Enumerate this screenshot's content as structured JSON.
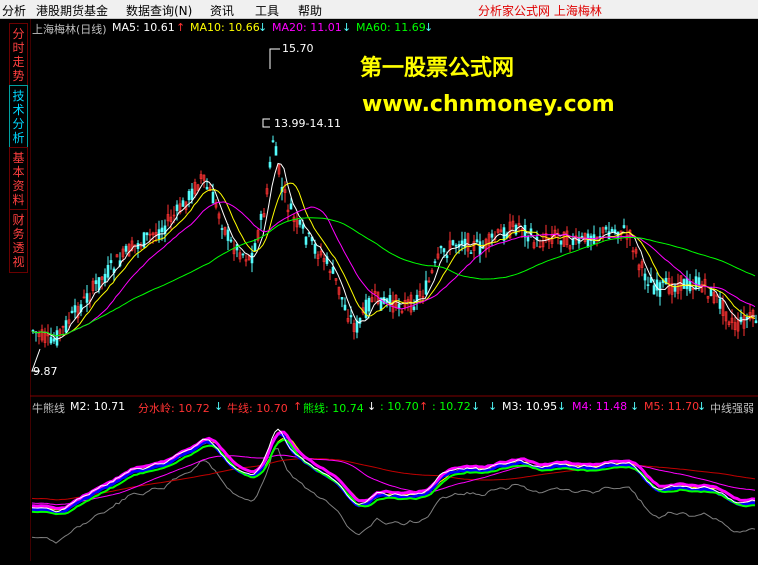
{
  "menu": {
    "items": [
      "分析",
      "港股期货基金",
      "数据查询(N)",
      "资讯",
      "工具",
      "帮助"
    ],
    "site_title": "分析家公式网  上海梅林"
  },
  "side_tabs": [
    "分时走势",
    "技术分析",
    "基本资料",
    "财务透视"
  ],
  "main_chart": {
    "stock_label": "上海梅林(日线)",
    "ma5": "MA5: 10.61",
    "ma10": "MA10: 10.66",
    "ma20": "MA20: 11.01",
    "ma60": "MA60: 11.69",
    "high_label": "15.70",
    "range_label": "13.99-14.11",
    "low_label": "9.87"
  },
  "watermark": {
    "line1": "第一股票公式网",
    "line2": "www.chnmoney.com"
  },
  "indicator": {
    "name": "牛熊线",
    "m2": "M2: 10.71",
    "fenshuiling": "分水岭: 10.72",
    "niuxian": "牛线: 10.70",
    "xiongxian": "熊线: 10.74",
    "v1": ": 10.70",
    "v2": ": 10.72",
    "m3": "M3: 10.95",
    "m4": "M4: 11.48",
    "m5": "M5: 11.70",
    "zhongxian": "中线强弱"
  },
  "colors": {
    "up": "#ff3232",
    "down": "#54fcfc",
    "ma5": "#ffffff",
    "ma10": "#ffff00",
    "ma20": "#ff00ff",
    "ma60": "#00ff00"
  }
}
